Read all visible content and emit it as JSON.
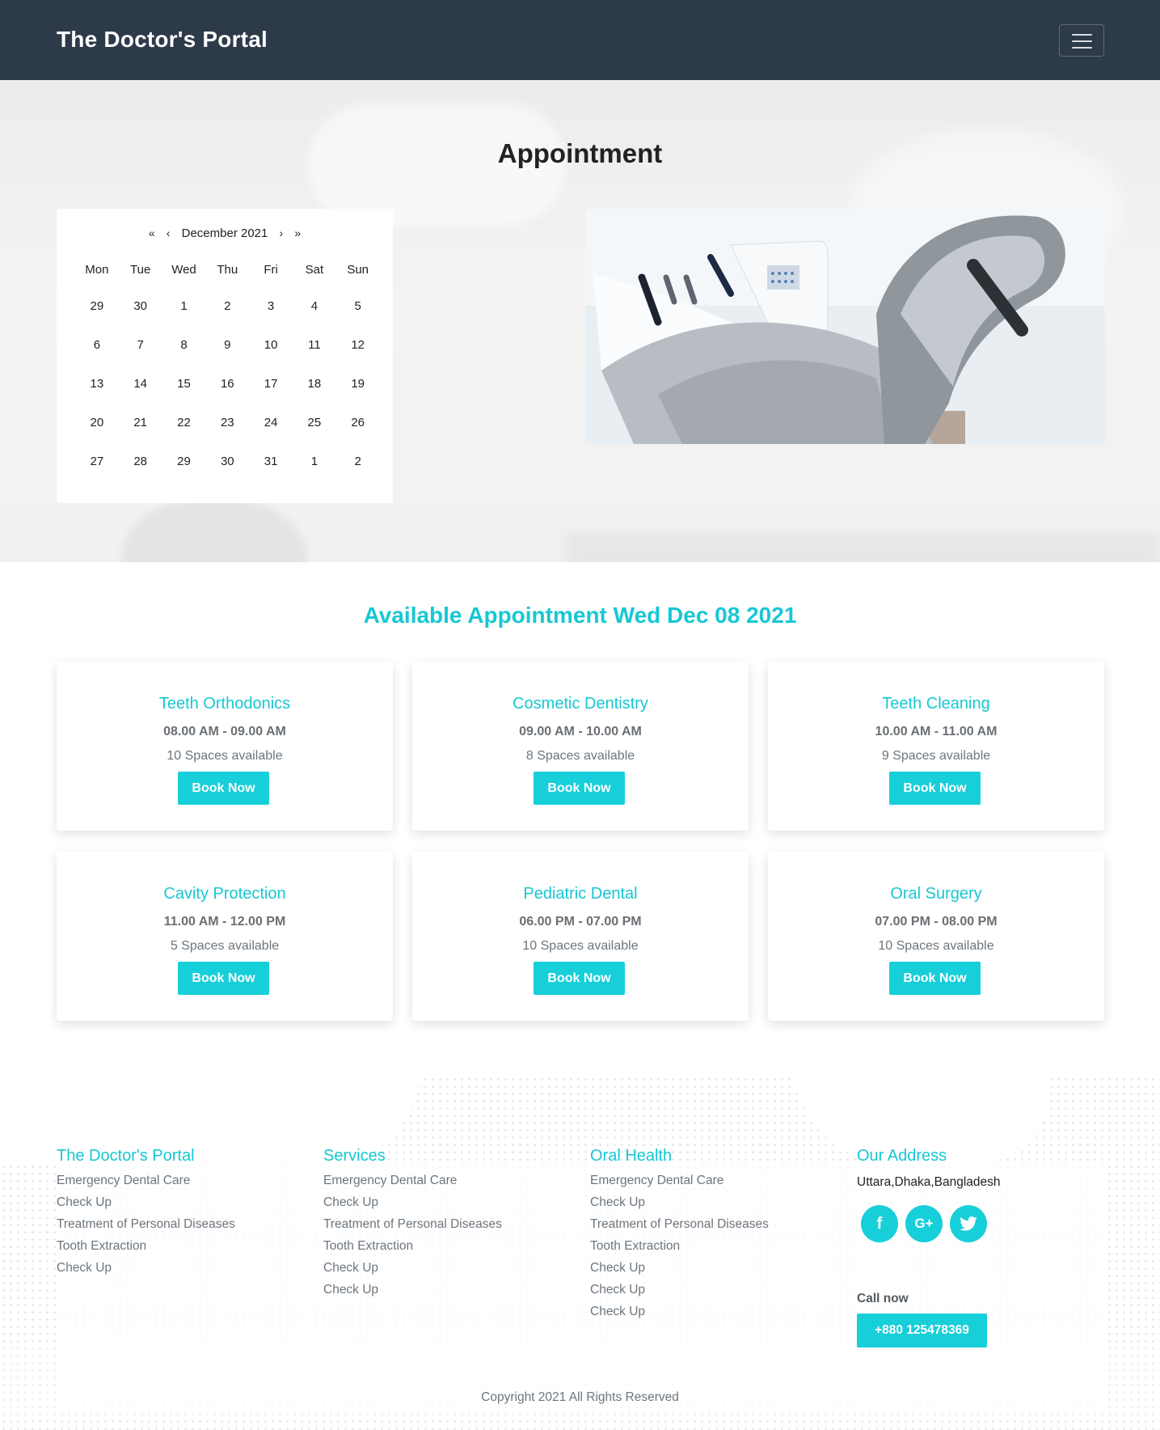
{
  "navbar": {
    "brand": "The Doctor's Portal",
    "toggler_icon": "hamburger-menu-icon"
  },
  "hero": {
    "title": "Appointment",
    "calendar": {
      "first": "«",
      "prev": "‹",
      "month_label": "December 2021",
      "next": "›",
      "last": "»",
      "weekdays": [
        "Mon",
        "Tue",
        "Wed",
        "Thu",
        "Fri",
        "Sat",
        "Sun"
      ],
      "weeks": [
        [
          "29",
          "30",
          "1",
          "2",
          "3",
          "4",
          "5"
        ],
        [
          "6",
          "7",
          "8",
          "9",
          "10",
          "11",
          "12"
        ],
        [
          "13",
          "14",
          "15",
          "16",
          "17",
          "18",
          "19"
        ],
        [
          "20",
          "21",
          "22",
          "23",
          "24",
          "25",
          "26"
        ],
        [
          "27",
          "28",
          "29",
          "30",
          "31",
          "1",
          "2"
        ]
      ]
    }
  },
  "available": {
    "title": "Available Appointment Wed Dec 08 2021",
    "cards": [
      {
        "title": "Teeth Orthodonics",
        "time": "08.00 AM - 09.00 AM",
        "spaces": "10 Spaces available",
        "button": "Book Now"
      },
      {
        "title": "Cosmetic Dentistry",
        "time": "09.00 AM - 10.00 AM",
        "spaces": "8 Spaces available",
        "button": "Book Now"
      },
      {
        "title": "Teeth Cleaning",
        "time": "10.00 AM - 11.00 AM",
        "spaces": "9 Spaces available",
        "button": "Book Now"
      },
      {
        "title": "Cavity Protection",
        "time": "11.00 AM - 12.00 PM",
        "spaces": "5 Spaces available",
        "button": "Book Now"
      },
      {
        "title": "Pediatric Dental",
        "time": "06.00 PM - 07.00 PM",
        "spaces": "10 Spaces available",
        "button": "Book Now"
      },
      {
        "title": "Oral Surgery",
        "time": "07.00 PM - 08.00 PM",
        "spaces": "10 Spaces available",
        "button": "Book Now"
      }
    ]
  },
  "footer": {
    "columns": [
      {
        "heading": "The Doctor's Portal",
        "items": [
          "Emergency Dental Care",
          "Check Up",
          "Treatment of Personal Diseases",
          "Tooth Extraction",
          "Check Up"
        ]
      },
      {
        "heading": "Services",
        "items": [
          "Emergency Dental Care",
          "Check Up",
          "Treatment of Personal Diseases",
          "Tooth Extraction",
          "Check Up",
          "Check Up"
        ]
      },
      {
        "heading": "Oral Health",
        "items": [
          "Emergency Dental Care",
          "Check Up",
          "Treatment of Personal Diseases",
          "Tooth Extraction",
          "Check Up",
          "Check Up",
          "Check Up"
        ]
      }
    ],
    "address": {
      "heading": "Our Address",
      "text": "Uttara,Dhaka,Bangladesh",
      "socials": [
        {
          "icon": "facebook-icon",
          "glyph": "f"
        },
        {
          "icon": "google-plus-icon",
          "glyph": "G+"
        },
        {
          "icon": "twitter-icon",
          "glyph": ""
        }
      ],
      "call_label": "Call now",
      "phone": "+880 125478369"
    },
    "copyright": "Copyright 2021 All Rights Reserved"
  },
  "colors": {
    "navbar": "#2d3a4a",
    "accent": "#17cfd9",
    "heading_accent": "#16c8d3",
    "muted_text": "#6c757d"
  }
}
